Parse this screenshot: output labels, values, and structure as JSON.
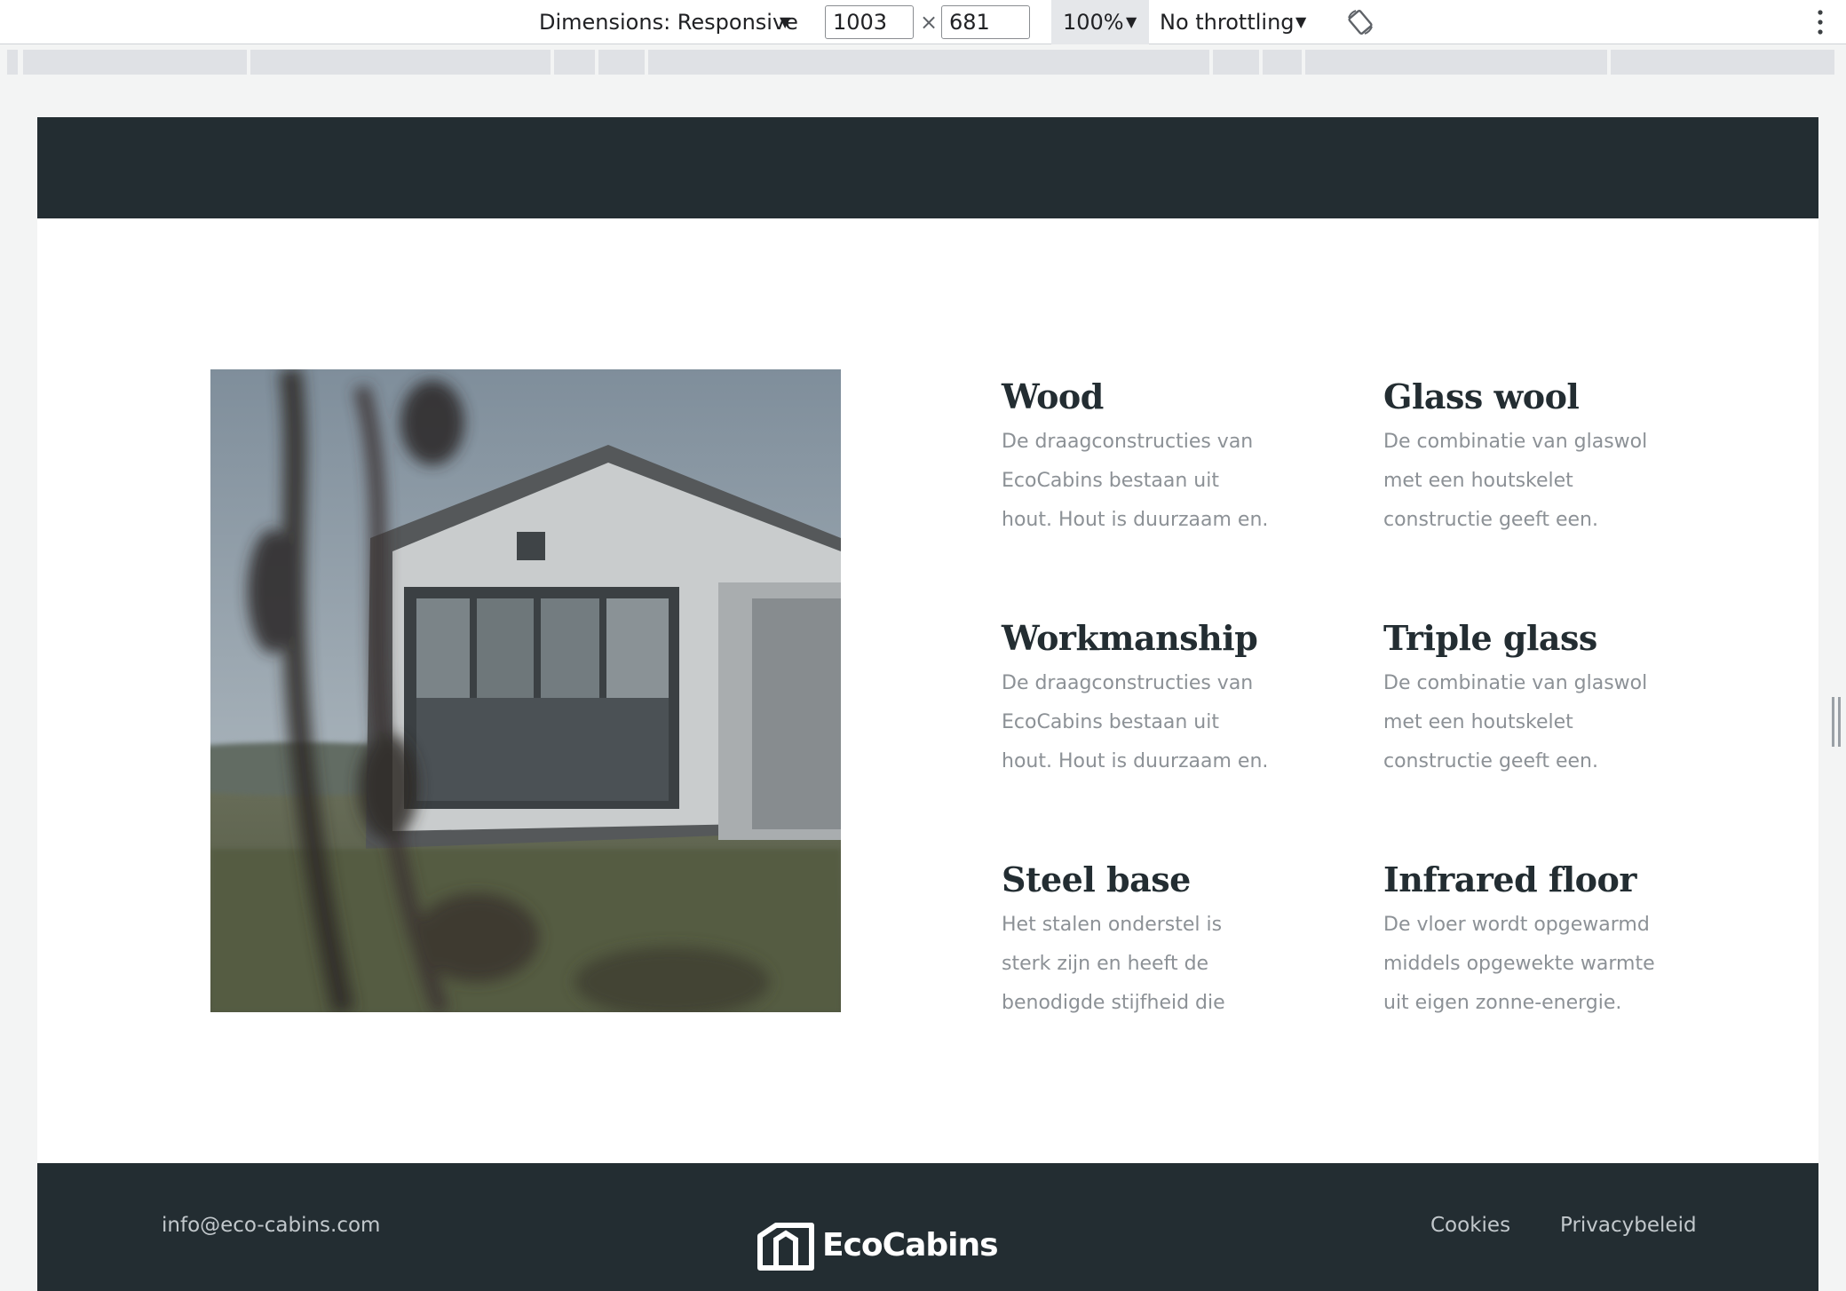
{
  "devtools": {
    "dimensions_label": "Dimensions: Responsive",
    "width_value": "1003",
    "times": "×",
    "height_value": "681",
    "zoom": "100%",
    "throttling": "No throttling",
    "caret": "▼"
  },
  "features": [
    {
      "title": "Wood",
      "lines": [
        "De draagconstructies van",
        "EcoCabins bestaan uit",
        "hout. Hout is duurzaam en."
      ]
    },
    {
      "title": "Glass wool",
      "lines": [
        "De combinatie van glaswol",
        "met een houtskelet",
        "constructie geeft een."
      ]
    },
    {
      "title": "Workmanship",
      "lines": [
        "De draagconstructies van",
        "EcoCabins bestaan uit",
        "hout. Hout is duurzaam en."
      ]
    },
    {
      "title": "Triple glass",
      "lines": [
        "De combinatie van glaswol",
        "met een houtskelet",
        "constructie geeft een."
      ]
    },
    {
      "title": "Steel base",
      "lines": [
        "Het stalen onderstel is",
        "sterk zijn en heeft de",
        "benodigde stijfheid die"
      ]
    },
    {
      "title": "Infrared floor",
      "lines": [
        "De vloer wordt opgewarmd",
        "middels opgewekte warmte",
        "uit eigen zonne-energie."
      ]
    }
  ],
  "footer": {
    "email": "info@eco-cabins.com",
    "logo_text": "EcoCabins",
    "cookies": "Cookies",
    "privacy": "Privacybeleid"
  },
  "colors": {
    "header_bg": "#232d32",
    "heading": "#232d32",
    "body_text": "#8c9196"
  },
  "icons": {
    "rotate": "rotate-icon",
    "menu": "kebab-menu-icon",
    "logo": "cabin-logo-icon"
  }
}
